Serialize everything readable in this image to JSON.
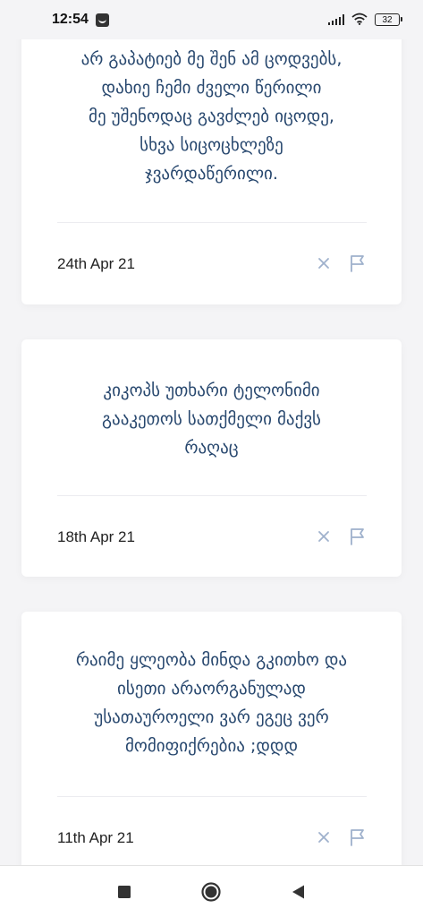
{
  "status_bar": {
    "time": "12:54",
    "battery": "32"
  },
  "feed": {
    "cards": [
      {
        "text": "არ გაპატიებ მე შენ ამ ცოდვებს,\nდახიე ჩემი ძველი წერილი\nმე უშენოდაც გავძლებ იცოდე,\nსხვა სიცოცხლეზე\nჯვარდაწერილი.",
        "date": "24th Apr 21"
      },
      {
        "text": "კიკოპს უთხარი ტელონიმი\nგააკეთოს სათქმელი მაქვს\nრაღაც",
        "date": "18th Apr 21"
      },
      {
        "text": "რაიმე ყლეობა მინდა გკითხო და\nისეთი არაორგანულად\nუსათაუროელი ვარ ეგეც ვერ\nმომიფიქრებია ;დდდ",
        "date": "11th Apr 21"
      }
    ]
  },
  "colors": {
    "text": "#27476e",
    "icon": "#9fb1cc",
    "background": "#f4f4f6"
  }
}
